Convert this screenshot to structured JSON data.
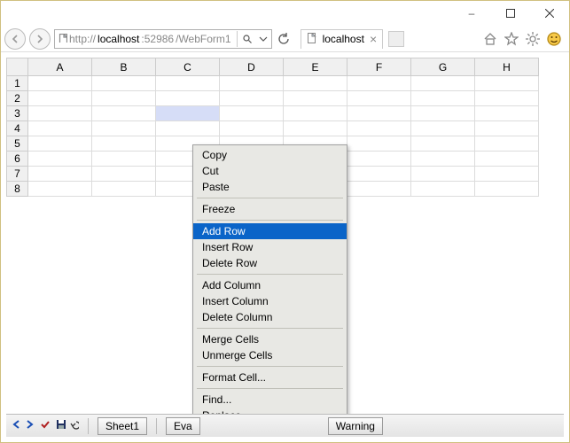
{
  "window": {
    "minimize": "–",
    "maximize": "▢",
    "close": "✕"
  },
  "nav": {
    "protocol": "http://",
    "host": "localhost",
    "port": ":52986",
    "path": "/WebForm1",
    "search_icon": "search",
    "refresh_icon": "refresh"
  },
  "tab": {
    "title": "localhost",
    "close": "×"
  },
  "columns": [
    "A",
    "B",
    "C",
    "D",
    "E",
    "F",
    "G",
    "H"
  ],
  "rows": [
    "1",
    "2",
    "3",
    "4",
    "5",
    "6",
    "7",
    "8"
  ],
  "selected_cell": {
    "col": "C",
    "row": "3"
  },
  "context_menu": {
    "groups": [
      [
        "Copy",
        "Cut",
        "Paste"
      ],
      [
        "Freeze"
      ],
      [
        "Add Row",
        "Insert Row",
        "Delete Row"
      ],
      [
        "Add Column",
        "Insert Column",
        "Delete Column"
      ],
      [
        "Merge Cells",
        "Unmerge Cells"
      ],
      [
        "Format Cell..."
      ],
      [
        "Find...",
        "Replace..."
      ]
    ],
    "highlighted": "Add Row"
  },
  "footer": {
    "sheet_tab": "Sheet1",
    "warning_btn": "Warning",
    "eval_btn_prefix": "Eva"
  }
}
